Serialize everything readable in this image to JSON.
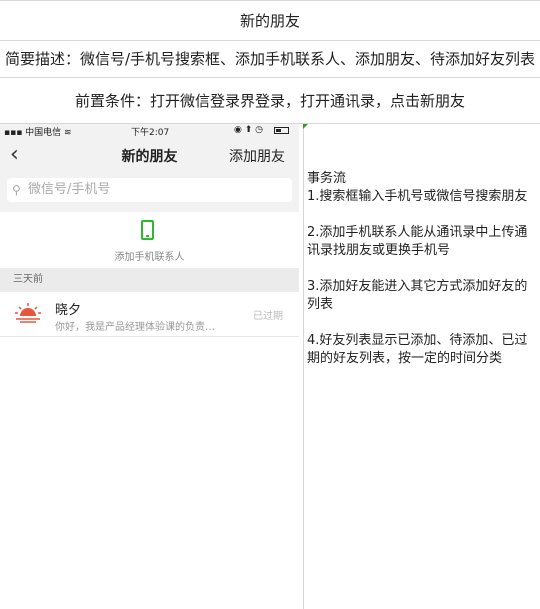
{
  "header": {
    "title": "新的朋友",
    "summary": "简要描述：微信号/手机号搜索框、添加手机联系人、添加朋友、待添加好友列表",
    "precondition": "前置条件：打开微信登录界登录，打开通讯录，点击新朋友"
  },
  "phone": {
    "status": {
      "carrier": "中国电信",
      "time": "下午2:07"
    },
    "nav": {
      "back": "‹",
      "title": "新的朋友",
      "action": "添加朋友"
    },
    "search": {
      "placeholder": "微信号/手机号"
    },
    "add_contacts_label": "添加手机联系人",
    "section_label": "三天前",
    "friend": {
      "name": "晓夕",
      "message": "你好，我是产品经理体验课的负责…",
      "status": "已过期"
    }
  },
  "flow": {
    "title": "事务流",
    "steps": [
      "1.搜索框输入手机号或微信号搜索朋友",
      "2.添加手机联系人能从通讯录中上传通讯录找朋友或更换手机号",
      "3.添加好友能进入其它方式添加好友的列表",
      "4.好友列表显示已添加、待添加、已过期的好友列表，按一定的时间分类"
    ]
  },
  "colors": {
    "accent": "#2eb82e",
    "avatar": "#e8553e"
  }
}
